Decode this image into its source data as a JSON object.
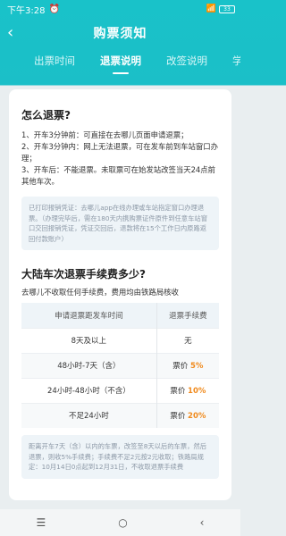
{
  "status": {
    "time": "下午3:28",
    "alarm_icon": "alarm-clock-icon",
    "wifi_icon": "wifi-icon",
    "battery": "33"
  },
  "header": {
    "title": "购票须知"
  },
  "tabs": [
    "出票时间",
    "退票说明",
    "改签说明",
    "学"
  ],
  "section1": {
    "heading": "怎么退票?",
    "line1": "1、开车3分钟前：可直接在去哪儿页面申请退票；",
    "line2": "2、开车3分钟内：网上无法退票，可在发车前到车站窗口办理；",
    "line3": "3、开车后：不能退票。未取票可在始发站改签当天24点前其他车次。",
    "note": "已打印报销凭证：去哪儿app在线办理或车站指定窗口办理退票。（办理完毕后，需在180天内携购票证件原件到任意车站窗口交回报销凭证，凭证交回后，退款将在15个工作日内原路返回付款账户）"
  },
  "section2": {
    "heading": "大陆车次退票手续费多少?",
    "sub": "去哪儿不收取任何手续费，费用均由铁路局核收",
    "table": {
      "headers": [
        "申请退票距发车时间",
        "退票手续费"
      ],
      "rows": [
        {
          "time": "8天及以上",
          "prefix": "无",
          "rate": ""
        },
        {
          "time": "48小时-7天（含）",
          "prefix": "票价",
          "rate": "5%"
        },
        {
          "time": "24小时-48小时（不含）",
          "prefix": "票价",
          "rate": "10%"
        },
        {
          "time": "不足24小时",
          "prefix": "票价",
          "rate": "20%"
        }
      ]
    },
    "note": "距离开车7天（含）以内的车票，改签至8天以后的车票，然后退票，则收5%手续费；手续费不足2元按2元收取；铁路局规定：10月14日0点起到12月31日，不收取退票手续费"
  },
  "navbar": {
    "menu": "☰",
    "home": "○",
    "back": "‹"
  }
}
